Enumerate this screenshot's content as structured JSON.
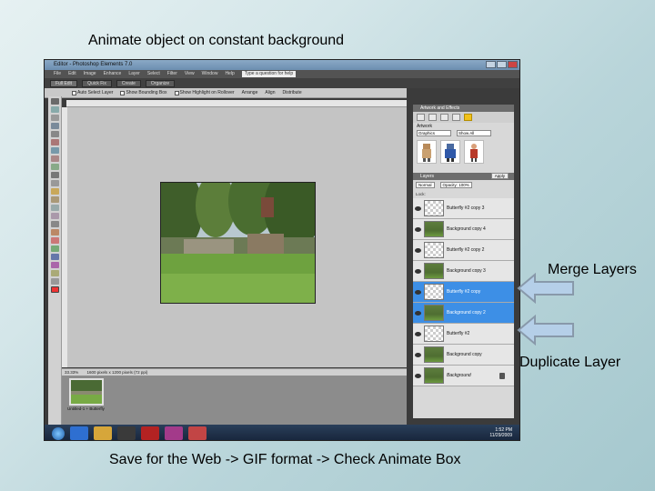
{
  "captions": {
    "title": "Animate object on constant background",
    "bottom": "Save for the Web -> GIF format -> Check Animate Box",
    "merge": "Merge Layers",
    "duplicate": "Duplicate Layer"
  },
  "colors": {
    "arrow_fill": "#b5cfe8",
    "arrow_stroke": "#8899aa",
    "selected_layer": "#3d8fe6"
  },
  "app": {
    "title": "Editor - Photoshop Elements 7.0",
    "menu": [
      "File",
      "Edit",
      "Image",
      "Enhance",
      "Layer",
      "Select",
      "Filter",
      "View",
      "Window",
      "Help"
    ],
    "help_search": "Type a question for help",
    "modes": [
      "Full Edit",
      "Quick Fix",
      "Create",
      "Organize"
    ],
    "options": [
      "Auto Select Layer",
      "Show Bounding Box",
      "Show Highlight on Rollover",
      "Arrange",
      "Align",
      "Distribute"
    ]
  },
  "canvas_status": {
    "zoom": "33.33%",
    "doc_info": "1600 pixels x 1200 pixels (72 ppi)"
  },
  "project_bin": {
    "item_label": "Untitled-1 + Butterfly"
  },
  "panel": {
    "artwork_effects": "Artwork and Effects",
    "artwork_label": "Artwork",
    "select_a": "Graphics",
    "select_b": "Show All",
    "apply": "Apply",
    "layers_title": "Layers",
    "blend_mode": "Normal",
    "opacity": "Opacity: 100%",
    "lock": "Lock:",
    "layers": [
      {
        "name": "Butterfly #2 copy 3",
        "thumb": "trans",
        "selected": false
      },
      {
        "name": "Background copy 4",
        "thumb": "img",
        "selected": false
      },
      {
        "name": "Butterfly #2 copy 2",
        "thumb": "trans",
        "selected": false
      },
      {
        "name": "Background copy 3",
        "thumb": "img",
        "selected": false
      },
      {
        "name": "Butterfly #2 copy",
        "thumb": "trans",
        "selected": true
      },
      {
        "name": "Background copy 2",
        "thumb": "img",
        "selected": true
      },
      {
        "name": "Butterfly #2",
        "thumb": "trans",
        "selected": false
      },
      {
        "name": "Background copy",
        "thumb": "img",
        "selected": false
      },
      {
        "name": "Background",
        "thumb": "img",
        "selected": false,
        "italic": true,
        "locked": true
      }
    ]
  },
  "taskbar": {
    "time": "1:52 PM",
    "date": "11/29/2009"
  }
}
